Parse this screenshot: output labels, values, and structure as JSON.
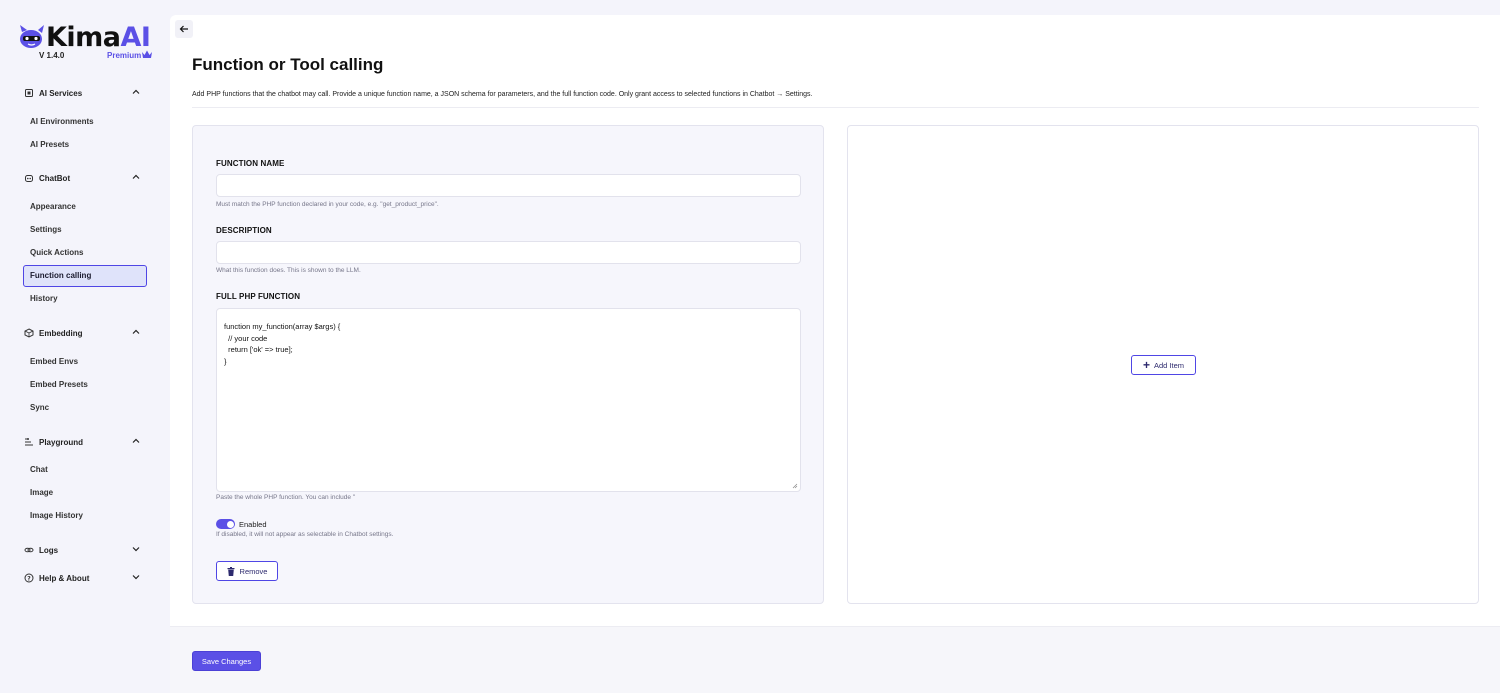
{
  "app": {
    "logo_main": "Kima",
    "logo_accent": "AI",
    "version": "V 1.4.0",
    "edition": "Premium"
  },
  "colors": {
    "accent": "#5b50e6",
    "active_nav_bg": "#dfe3fa"
  },
  "sidebar": {
    "sections": [
      {
        "label": "AI Services",
        "icon": "chip-icon",
        "expanded": true,
        "items": [
          "AI Environments",
          "AI Presets"
        ]
      },
      {
        "label": "ChatBot",
        "icon": "bot-icon",
        "expanded": true,
        "items": [
          "Appearance",
          "Settings",
          "Quick Actions",
          "Function calling",
          "History"
        ]
      },
      {
        "label": "Embedding",
        "icon": "cube-icon",
        "expanded": true,
        "items": [
          "Embed Envs",
          "Embed Presets",
          "Sync"
        ]
      },
      {
        "label": "Playground",
        "icon": "sliders-icon",
        "expanded": true,
        "items": [
          "Chat",
          "Image",
          "Image History"
        ]
      },
      {
        "label": "Logs",
        "icon": "link-icon",
        "expanded": false,
        "items": []
      },
      {
        "label": "Help & About",
        "icon": "help-icon",
        "expanded": false,
        "items": []
      }
    ],
    "active_item": "Function calling"
  },
  "page": {
    "title": "Function or Tool calling",
    "description": "Add PHP functions that the chatbot may call. Provide a unique function name, a JSON schema for parameters, and the full function code. Only grant access to selected functions in Chatbot → Settings."
  },
  "form": {
    "function_name": {
      "label": "FUNCTION NAME",
      "value": "",
      "help": "Must match the PHP function declared in your code, e.g. \"get_product_price\"."
    },
    "description": {
      "label": "DESCRIPTION",
      "value": "",
      "help": "What this function does. This is shown to the LLM."
    },
    "php_function": {
      "label": "FULL PHP FUNCTION",
      "value": "function my_function(array $args) {\n  // your code\n  return ['ok' => true];\n}",
      "help": "Paste the whole PHP function. You can include \""
    },
    "enabled": {
      "label": "Enabled",
      "checked": true,
      "help": "If disabled, it will not appear as selectable in Chatbot settings."
    },
    "remove_label": "Remove"
  },
  "right_panel": {
    "add_item_label": "Add Item"
  },
  "footer": {
    "save_label": "Save Changes"
  }
}
